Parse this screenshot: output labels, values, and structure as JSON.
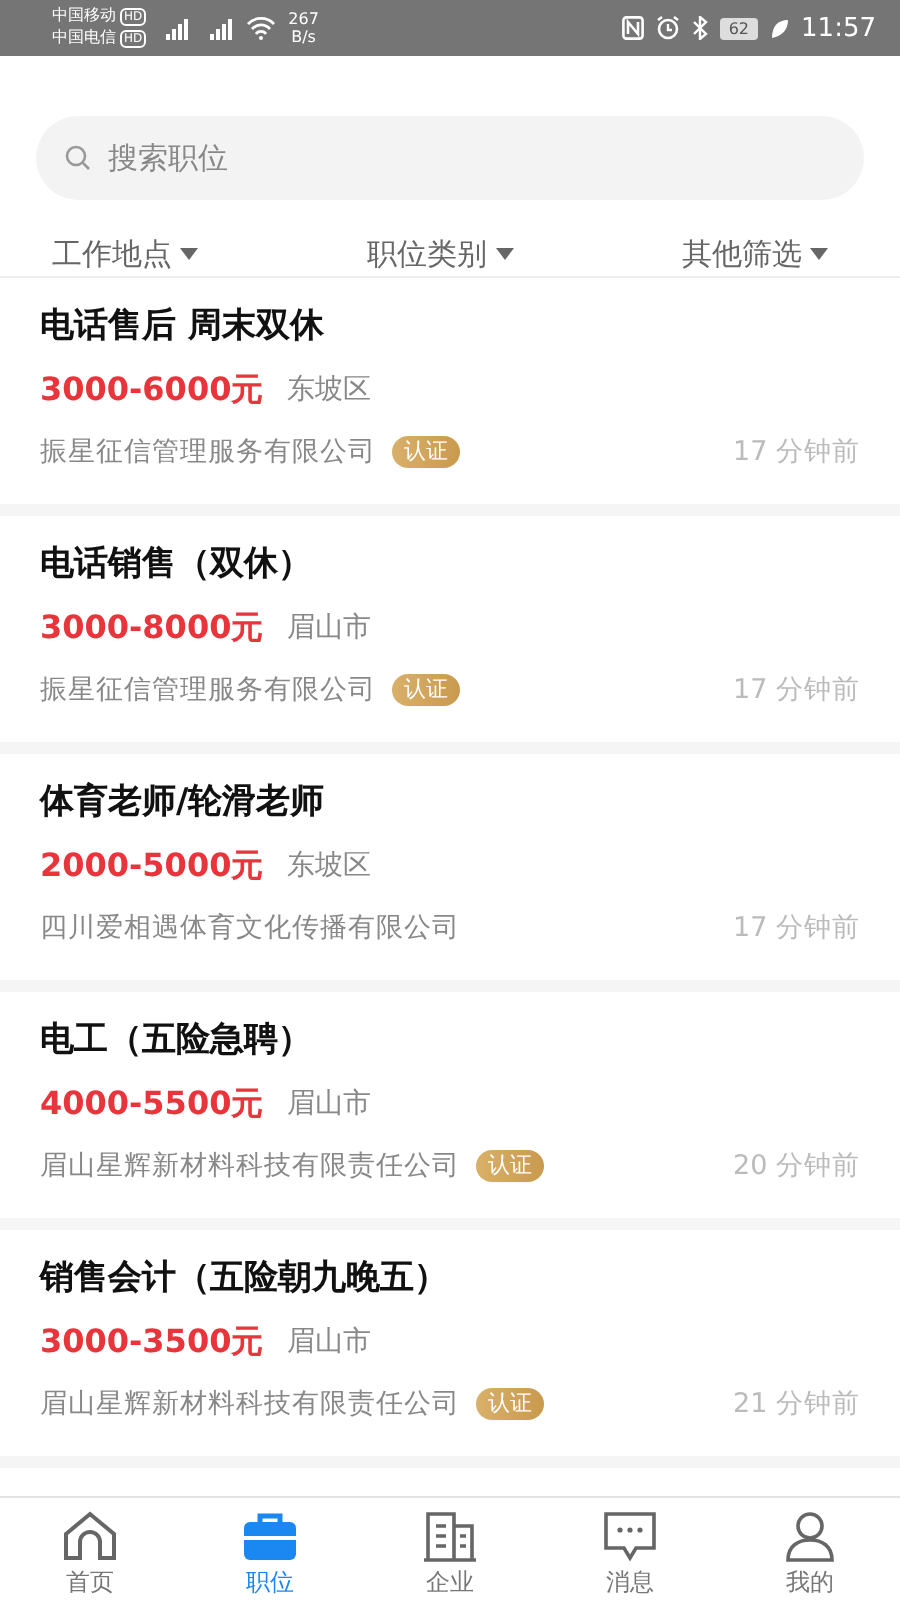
{
  "status_bar": {
    "carriers": [
      {
        "name": "中国移动",
        "badge": "HD"
      },
      {
        "name": "中国电信",
        "badge": "HD"
      }
    ],
    "speed": [
      "267",
      "B/s"
    ],
    "battery": "62",
    "time": "11:57"
  },
  "search": {
    "placeholder": "搜索职位"
  },
  "filters": [
    {
      "label": "工作地点"
    },
    {
      "label": "职位类别"
    },
    {
      "label": "其他筛选"
    }
  ],
  "jobs": [
    {
      "title": "电话售后 周末双休",
      "salary": "3000-6000元",
      "location": "东坡区",
      "company": "振星征信管理服务有限公司",
      "badge": "认证",
      "time": "17 分钟前"
    },
    {
      "title": "电话销售（双休）",
      "salary": "3000-8000元",
      "location": "眉山市",
      "company": "振星征信管理服务有限公司",
      "badge": "认证",
      "time": "17 分钟前"
    },
    {
      "title": "体育老师/轮滑老师",
      "salary": "2000-5000元",
      "location": "东坡区",
      "company": "四川爱相遇体育文化传播有限公司",
      "time": "17 分钟前"
    },
    {
      "title": "电工（五险急聘）",
      "salary": "4000-5500元",
      "location": "眉山市",
      "company": "眉山星辉新材料科技有限责任公司",
      "badge": "认证",
      "time": "20 分钟前"
    },
    {
      "title": "销售会计（五险朝九晚五）",
      "salary": "3000-3500元",
      "location": "眉山市",
      "company": "眉山星辉新材料科技有限责任公司",
      "badge": "认证",
      "time": "21 分钟前"
    }
  ],
  "tabs": [
    {
      "label": "首页",
      "kind": "home",
      "selected": false
    },
    {
      "label": "职位",
      "kind": "jobs",
      "selected": true
    },
    {
      "label": "企业",
      "kind": "company",
      "selected": false
    },
    {
      "label": "消息",
      "kind": "messages",
      "selected": false
    },
    {
      "label": "我的",
      "kind": "profile",
      "selected": false
    }
  ]
}
